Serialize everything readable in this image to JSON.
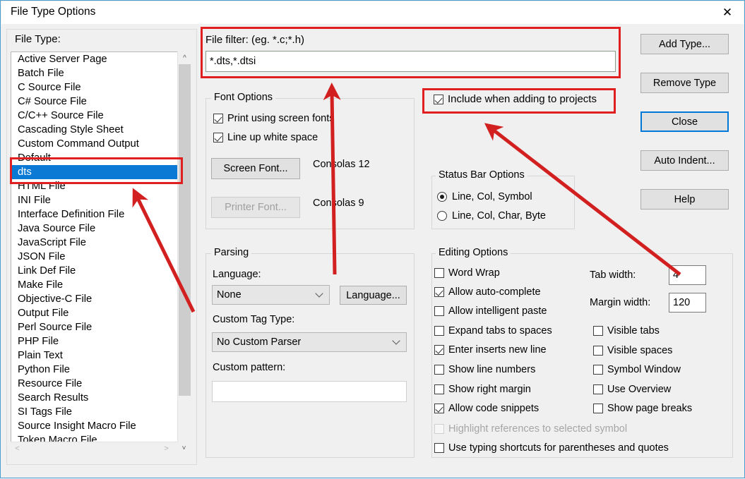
{
  "window": {
    "title": "File Type Options",
    "close_icon": "close-icon",
    "accent": "#0078d7",
    "annotation_color": "#e02020",
    "selection_color": "#0b7ad5"
  },
  "file_type": {
    "label": "File Type:",
    "items": [
      "Active Server Page",
      "Batch File",
      "C Source File",
      "C# Source File",
      "C/C++ Source File",
      "Cascading Style Sheet",
      "Custom Command Output",
      "Default",
      "dts",
      "HTML File",
      "INI File",
      "Interface Definition File",
      "Java Source File",
      "JavaScript File",
      "JSON File",
      "Link Def File",
      "Make File",
      "Objective-C File",
      "Output File",
      "Perl Source File",
      "PHP File",
      "Plain Text",
      "Python File",
      "Resource File",
      "Search Results",
      "SI Tags File",
      "Source Insight Macro File",
      "Token Macro File"
    ],
    "selected": "dts",
    "scroll_up_icon": "chevron-up-icon",
    "scroll_down_icon": "chevron-down-icon",
    "scroll_left_icon": "chevron-left-icon",
    "scroll_right_icon": "chevron-right-icon"
  },
  "file_filter": {
    "label": "File filter: (eg. *.c;*.h)",
    "value": "*.dts,*.dtsi"
  },
  "include_projects": {
    "label": "Include when adding to projects",
    "checked": true
  },
  "font_options": {
    "title": "Font Options",
    "checkboxes": [
      {
        "label": "Print using screen fonts",
        "checked": true
      },
      {
        "label": "Line up white space",
        "checked": true
      }
    ],
    "screen_font_button": "Screen Font...",
    "screen_font_value": "Consolas 12",
    "printer_font_button": "Printer Font...",
    "printer_font_value": "Consolas 9",
    "printer_font_disabled": true
  },
  "status_bar": {
    "title": "Status Bar Options",
    "options": [
      {
        "label": "Line, Col, Symbol",
        "checked": true
      },
      {
        "label": "Line, Col, Char, Byte",
        "checked": false
      }
    ]
  },
  "parsing": {
    "title": "Parsing",
    "language_label": "Language:",
    "language_value": "None",
    "language_button": "Language...",
    "custom_tag_label": "Custom Tag Type:",
    "custom_tag_value": "No Custom Parser",
    "custom_pattern_label": "Custom pattern:",
    "custom_pattern_value": ""
  },
  "editing_options": {
    "title": "Editing Options",
    "left_checkboxes": [
      {
        "label": "Word Wrap",
        "checked": false
      },
      {
        "label": "Allow auto-complete",
        "checked": true
      },
      {
        "label": "Allow intelligent paste",
        "checked": false
      },
      {
        "label": "Expand tabs to spaces",
        "checked": false
      },
      {
        "label": "Enter inserts new line",
        "checked": true
      },
      {
        "label": "Show line numbers",
        "checked": false
      },
      {
        "label": "Show right margin",
        "checked": false
      },
      {
        "label": "Allow code snippets",
        "checked": true
      }
    ],
    "tab_width_label": "Tab width:",
    "tab_width_value": "4",
    "margin_width_label": "Margin width:",
    "margin_width_value": "120",
    "right_checkboxes": [
      {
        "label": "Visible tabs",
        "checked": false
      },
      {
        "label": "Visible spaces",
        "checked": false
      },
      {
        "label": "Symbol Window",
        "checked": false
      },
      {
        "label": "Use Overview",
        "checked": false
      },
      {
        "label": "Show page breaks",
        "checked": false
      }
    ],
    "bottom_checkboxes": [
      {
        "label": "Highlight references to selected symbol",
        "checked": false,
        "disabled": true
      },
      {
        "label": "Use typing shortcuts for parentheses and quotes",
        "checked": false,
        "disabled": false
      }
    ]
  },
  "buttons": {
    "add_type": "Add Type...",
    "remove_type": "Remove Type",
    "close": "Close",
    "auto_indent": "Auto Indent...",
    "help": "Help"
  }
}
